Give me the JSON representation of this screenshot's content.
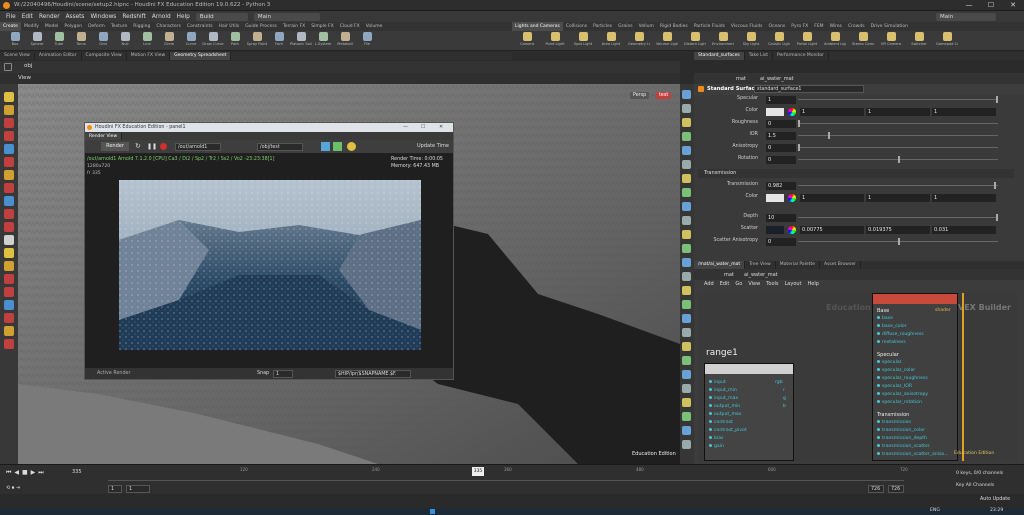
{
  "window": {
    "title": "W:/22040496/Houdini/scene/setup2.hipnc - Houdini FX Education Edition 19.0.622 - Python 3",
    "min": "—",
    "max": "☐",
    "close": "✕"
  },
  "menu": {
    "items": [
      "File",
      "Edit",
      "Render",
      "Assets",
      "Windows",
      "Redshift",
      "Arnold",
      "Help"
    ],
    "build": "Build",
    "desktop": "Main",
    "right_desktop": "Main"
  },
  "shelf": {
    "tabs_left": [
      "Create",
      "Modify",
      "Model",
      "Polygon",
      "Deform",
      "Texture",
      "Rigging",
      "Characters",
      "Constraints",
      "Hair Utils",
      "Guide Process",
      "Terrain FX",
      "Simple FX",
      "Cloud FX",
      "Volume"
    ],
    "tabs_right": [
      "Lights and Cameras",
      "Collisions",
      "Particles",
      "Grains",
      "Vellum",
      "Rigid Bodies",
      "Particle Fluids",
      "Viscous Fluids",
      "Oceans",
      "Pyro FX",
      "FEM",
      "Wires",
      "Crowds",
      "Drive Simulation"
    ],
    "tools_left": [
      "Box",
      "Sphere",
      "Tube",
      "Torus",
      "Grid",
      "Null",
      "Line",
      "Circle",
      "Curve",
      "Draw Curve",
      "Path",
      "Spray Paint",
      "Font",
      "Platonic Solids",
      "L-System",
      "Metaball",
      "File"
    ],
    "tools_right": [
      "Camera",
      "Point Light",
      "Spot Light",
      "Area Light",
      "Geometry Light",
      "Volume Light",
      "Distant Light",
      "Environment Light",
      "Sky Light",
      "Caustic Light",
      "Portal Light",
      "Ambient Light",
      "Stereo Camera",
      "VR Camera",
      "Switcher",
      "Gamepad Camera"
    ]
  },
  "pane_tabs_left": [
    "Scene View",
    "Animation Editor",
    "Composite View",
    "Motion FX View",
    "Geometry Spreadsheet"
  ],
  "pane_tabs_right": [
    "Standard_surfaces",
    "Take List",
    "Performance Monitor"
  ],
  "viewport": {
    "tab": "View",
    "path": "obj",
    "persp": "Persp",
    "cam": "test",
    "edu": "Education Edition"
  },
  "render_window": {
    "title": "Houdini FX Education Edition - panel1",
    "tab": "Render View",
    "render_btn": "Render",
    "rop_path": "/out/arnold1",
    "cam_path": "/obj/test",
    "update_time": "Update Time",
    "header_line": "/out/arnold1  Arnold 7.1.2.0 [CPU] Ca3 / Di2 / Sp2 / Tr2 / Ss2 / Vo2 -23:23:38[1]",
    "res": "1280x720",
    "frame": "fr 335",
    "render_time": "Render Time: 0:00:05",
    "memory": "Memory: 647.43 MB",
    "snap": "Snap",
    "snap_val": "1",
    "path": "$HIP/ipr/$SNAPNAME.$F.",
    "active_render": "Active Render"
  },
  "params": {
    "node_type": "Standard Surface",
    "node_name": "standard_surface1",
    "specular": "1",
    "spec_color": [
      "1",
      "1",
      "1"
    ],
    "roughness": "0",
    "ior": "1.5",
    "anisotropy": "0",
    "rotation": "0",
    "section_transmission": "Transmission",
    "transmission": "0.982",
    "trans_color": [
      "1",
      "1",
      "1"
    ],
    "depth": "10",
    "scatter": [
      "0.00775",
      "0.019375",
      "0.031"
    ],
    "scatter_anisotropy": "0",
    "labels": {
      "specular": "Specular",
      "color": "Color",
      "roughness": "Roughness",
      "ior": "IOR",
      "anisotropy": "Anisotropy",
      "rotation": "Rotation",
      "transmission": "Transmission",
      "depth": "Depth",
      "scatter": "Scatter",
      "scatter_anisotropy": "Scatter Anisotropy"
    },
    "path_mat": "mat",
    "path_node": "ai_water_mat"
  },
  "network": {
    "tabs": [
      "/mat/ai_water_mat",
      "Tree View",
      "Material Palette",
      "Asset Browser"
    ],
    "path_mat": "mat",
    "path_node": "ai_water_mat",
    "menu": [
      "Add",
      "Edit",
      "Go",
      "View",
      "Tools",
      "Layout",
      "Help"
    ],
    "watermark": "Education",
    "builder": "VEX Builder",
    "range_node": "range1",
    "range_inputs": [
      "input",
      "input_min",
      "input_max",
      "output_min",
      "output_max",
      "contrast",
      "contrast_pivot",
      "bias",
      "gain"
    ],
    "range_outputs": [
      "rgb",
      "r",
      "g",
      "b"
    ],
    "shader_out": "shader",
    "sections": [
      "Base",
      "Specular",
      "Transmission"
    ],
    "base_ports": [
      "base",
      "base_color",
      "diffuse_roughness",
      "metalness"
    ],
    "spec_ports": [
      "specular",
      "specular_color",
      "specular_roughness",
      "specular_IOR",
      "specular_anisotropy",
      "specular_rotation"
    ],
    "trans_ports": [
      "transmission",
      "transmission_color",
      "transmission_depth",
      "transmission_scatter",
      "transmission_scatter_aniso..."
    ],
    "edu": "Education Edition"
  },
  "timeline": {
    "current_frame": "335",
    "start": "1",
    "start2": "1",
    "end": "726",
    "end2": "726",
    "ticks": [
      "120",
      "240",
      "360",
      "480",
      "600",
      "720"
    ],
    "keys": "0 keys, 0/0 channels",
    "key_all": "Key All Channels",
    "auto_update": "Auto Update"
  },
  "taskbar": {
    "lang": "ENG",
    "time": "23:29"
  }
}
